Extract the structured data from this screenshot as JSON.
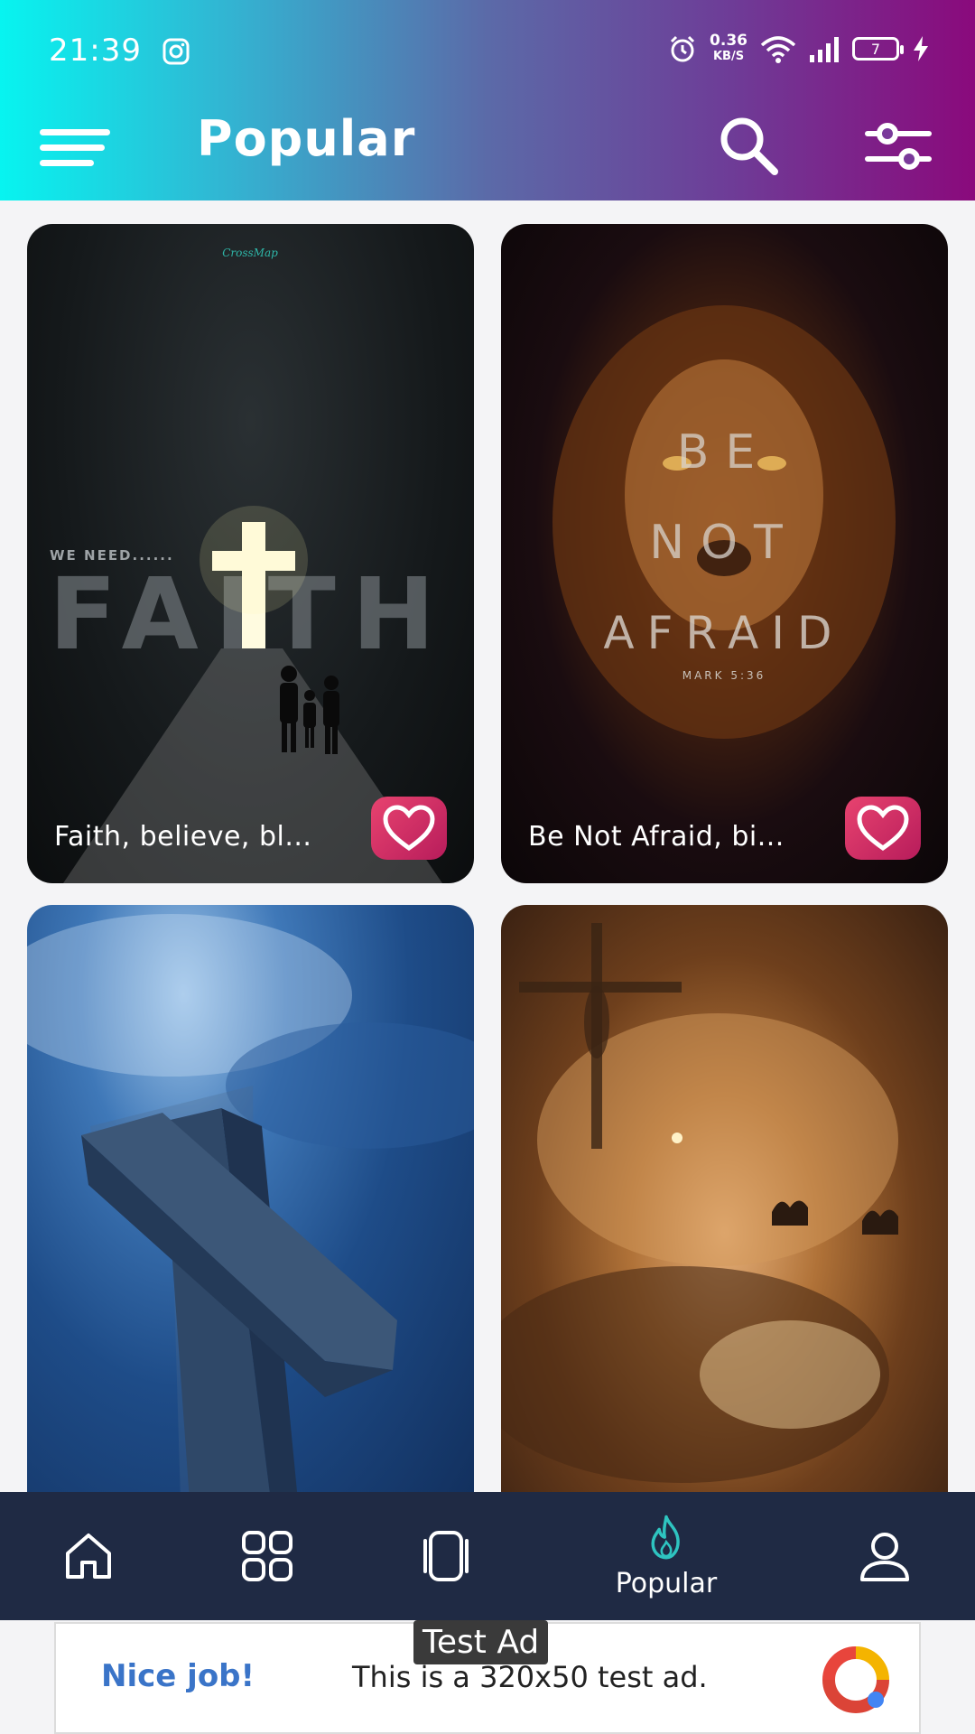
{
  "status": {
    "time": "21:39",
    "net_speed": "0.36",
    "net_unit": "KB/S",
    "battery": "7"
  },
  "header": {
    "title": "Popular",
    "icons": [
      "menu-icon",
      "search-icon",
      "filter-icon"
    ]
  },
  "cards": [
    {
      "caption": "Faith, believe, bl...",
      "art_text_small": "WE NEED......",
      "art_text_big": "FAITH",
      "watermark": "CrossMap"
    },
    {
      "caption": "Be Not Afraid, bi...",
      "art_lines": [
        "BE",
        "NOT",
        "AFRAID"
      ],
      "art_ref": "MARK 5:36"
    },
    {
      "caption": ""
    },
    {
      "caption": ""
    }
  ],
  "bottom_nav": {
    "items": [
      {
        "icon": "home-icon",
        "label": ""
      },
      {
        "icon": "categories-icon",
        "label": ""
      },
      {
        "icon": "wallpapers-icon",
        "label": ""
      },
      {
        "icon": "fire-icon",
        "label": "Popular",
        "active": true
      },
      {
        "icon": "profile-icon",
        "label": ""
      }
    ],
    "active_color": "#2ec4c0"
  },
  "ad": {
    "label": "Test Ad",
    "headline": "Nice job!",
    "body": "This is a 320x50 test ad."
  },
  "colors": {
    "nav_bg": "#1f2a44",
    "fav_button": "#d42f65",
    "gradient_start": "#07f4f0",
    "gradient_end": "#8a0a7c"
  }
}
